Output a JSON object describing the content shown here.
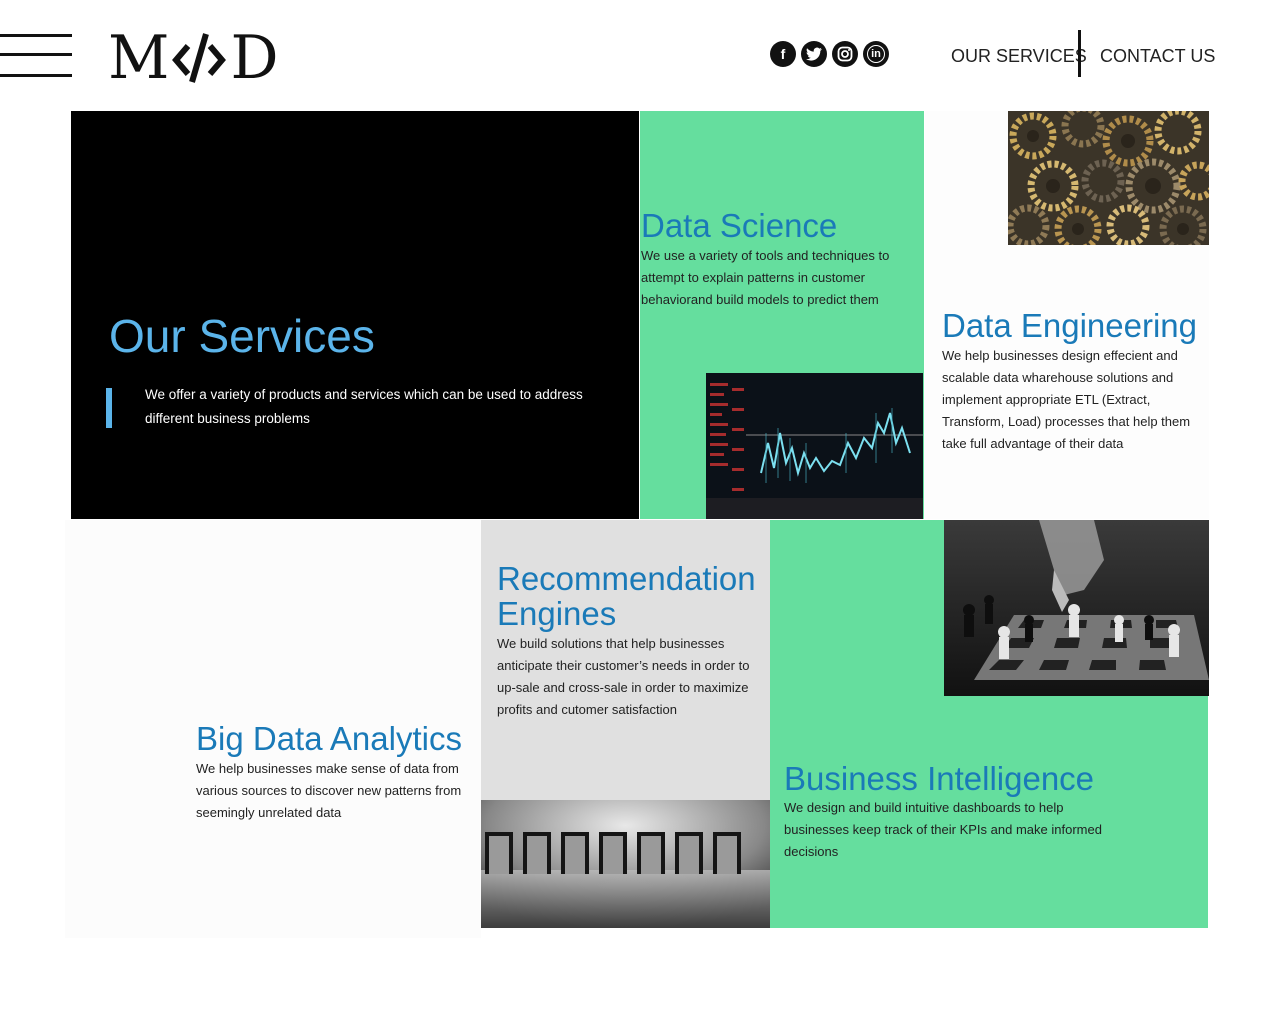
{
  "header": {
    "logo_left": "M",
    "logo_right": "D",
    "social": [
      {
        "icon": "facebook-icon",
        "glyph": "f"
      },
      {
        "icon": "twitter-icon",
        "glyph": "t"
      },
      {
        "icon": "instagram-icon",
        "glyph": "◎"
      },
      {
        "icon": "linkedin-icon",
        "glyph": "in"
      }
    ],
    "nav": {
      "services": "OUR SERVICES",
      "contact": "CONTACT US"
    }
  },
  "hero": {
    "title": "Our Services",
    "text": "We offer a variety of products and services which can be used to address different business problems"
  },
  "services": {
    "data_science": {
      "title": "Data Science",
      "text": "We use a variety of tools and techniques to attempt to explain patterns in customer behaviorand build models to predict them"
    },
    "data_engineering": {
      "title": "Data Engineering",
      "text": "We help businesses design effecient and scalable data wharehouse solutions and implement appropriate ETL (Extract, Transform, Load) processes that help them take full advantage of their data"
    },
    "big_data": {
      "title": "Big Data Analytics",
      "text": "We help businesses make sense of data from various sources to discover new patterns from seemingly unrelated data"
    },
    "recommendation": {
      "title": "Recommendation Engines",
      "text": "We build solutions that help businesses anticipate their customer’s needs in order to up-sale and cross-sale  in order to maximize profits and cutomer satisfaction"
    },
    "business_intelligence": {
      "title": "Business Intelligence",
      "text": "We design and build intuitive dashboards to help businesses keep track of their KPIs and make informed decisions"
    }
  },
  "colors": {
    "accent_blue": "#1a7ab8",
    "hero_blue": "#5bb4ea",
    "mint": "#65de9e",
    "grey_panel": "#e0e0e0"
  }
}
